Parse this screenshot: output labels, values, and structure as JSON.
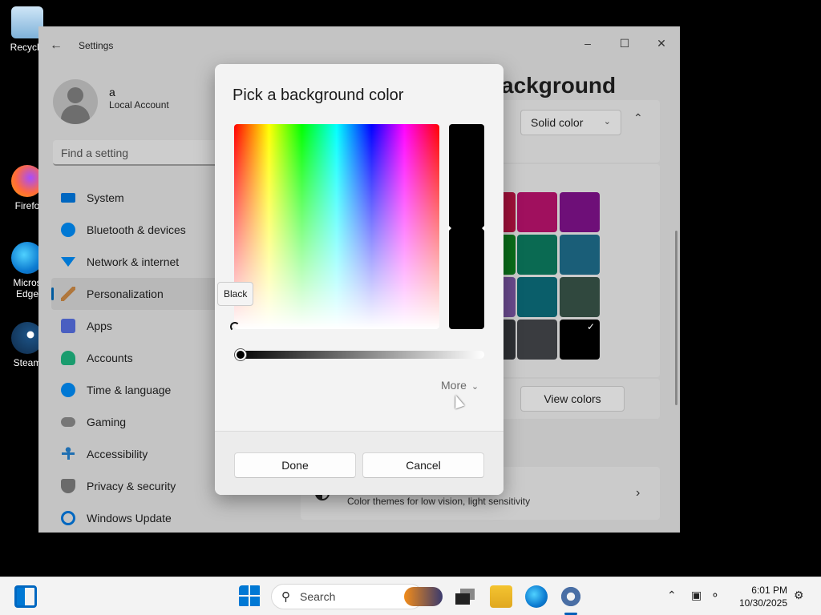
{
  "desktop": {
    "icons": [
      {
        "label": "Recycle",
        "icon": "recycle-bin-icon"
      },
      {
        "label": "Firefo",
        "icon": "firefox-icon"
      },
      {
        "label": "Micros Edge",
        "icon": "edge-icon"
      },
      {
        "label": "Steam",
        "icon": "steam-icon"
      }
    ]
  },
  "window": {
    "title": "Settings",
    "controls": {
      "minimize": "–",
      "maximize": "☐",
      "close": "✕"
    }
  },
  "user": {
    "name": "a",
    "account_type": "Local Account"
  },
  "search": {
    "placeholder": "Find a setting"
  },
  "nav": {
    "items": [
      {
        "label": "System",
        "icon": "system-icon",
        "color": "#0067c0"
      },
      {
        "label": "Bluetooth & devices",
        "icon": "bluetooth-icon",
        "color": "#0078d4"
      },
      {
        "label": "Network & internet",
        "icon": "network-icon",
        "color": "#0078d4"
      },
      {
        "label": "Personalization",
        "icon": "brush-icon",
        "color": "#b0773c",
        "active": true
      },
      {
        "label": "Apps",
        "icon": "apps-icon",
        "color": "#4a5fc1"
      },
      {
        "label": "Accounts",
        "icon": "accounts-icon",
        "color": "#1a9c6e"
      },
      {
        "label": "Time & language",
        "icon": "time-language-icon",
        "color": "#0078d4"
      },
      {
        "label": "Gaming",
        "icon": "gaming-icon",
        "color": "#666666"
      },
      {
        "label": "Accessibility",
        "icon": "accessibility-icon",
        "color": "#1f6fb2"
      },
      {
        "label": "Privacy & security",
        "icon": "shield-icon",
        "color": "#6b6b6b"
      },
      {
        "label": "Windows Update",
        "icon": "windows-update-icon",
        "color": "#0067c0"
      }
    ]
  },
  "background_page": {
    "title_partial": "ackground",
    "dropdown_value": "Solid color",
    "view_colors_label": "View colors",
    "contrast_description": "Color themes for low vision, light sensitivity",
    "swatches": [
      "#a0103a",
      "#a0105e",
      "#6e0f78",
      "#0a6e1a",
      "#0a6a52",
      "#1a5e78",
      "#6a4a8e",
      "#0a5e6a",
      "#30483e",
      "#2e3034",
      "#3a3c40",
      "#000000"
    ],
    "selected_swatch_index": 11
  },
  "dialog": {
    "title": "Pick a background color",
    "selected_color": "#000000",
    "selected_color_name": "Black",
    "value_level": 0,
    "more_label": "More",
    "done_label": "Done",
    "cancel_label": "Cancel"
  },
  "taskbar": {
    "search_label": "Search",
    "time": "6:01 PM",
    "date": "10/30/2025",
    "apps": [
      "start-icon",
      "widgets-icon",
      "task-view-icon",
      "file-explorer-icon",
      "edge-icon",
      "settings-icon"
    ]
  }
}
